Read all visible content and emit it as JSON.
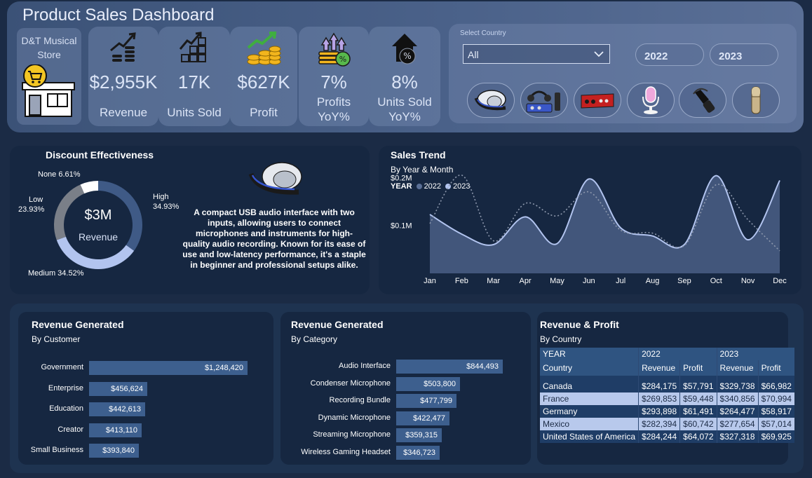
{
  "header": {
    "title": "Product Sales Dashboard",
    "store_name": "D&T Musical Store",
    "kpis": [
      {
        "value": "$2,955K",
        "label": "Revenue",
        "icon": "growth-coins-icon"
      },
      {
        "value": "17K",
        "label": "Units Sold",
        "icon": "boxes-growth-icon"
      },
      {
        "value": "$627K",
        "label": "Profit",
        "icon": "profit-coins-icon"
      },
      {
        "value": "7%",
        "label": "Profits YoY%",
        "icon": "profit-arrows-icon"
      },
      {
        "value": "8%",
        "label": "Units Sold YoY%",
        "icon": "house-percent-icon"
      }
    ],
    "country_filter": {
      "label": "Select Country",
      "value": "All"
    },
    "years": [
      "2022",
      "2023"
    ],
    "product_icons": [
      "headset-icon",
      "recording-bundle-icon",
      "audio-interface-icon",
      "streaming-mic-icon",
      "dynamic-mic-icon",
      "condenser-mic-icon"
    ]
  },
  "discount": {
    "title": "Discount Effectiveness",
    "center_value": "$3M",
    "center_label": "Revenue",
    "segments": [
      {
        "name": "High",
        "pct": "34.93%",
        "value": 34.93,
        "color": "#3f5a86"
      },
      {
        "name": "Medium",
        "pct": "34.52%",
        "value": 34.52,
        "color": "#b2c4ef"
      },
      {
        "name": "Low",
        "pct": "23.93%",
        "value": 23.93,
        "color": "#7a7f88"
      },
      {
        "name": "None",
        "pct": "6.61%",
        "value": 6.61,
        "color": "#ffffff"
      }
    ],
    "labels": {
      "none": "None 6.61%",
      "low_name": "Low",
      "low_pct": "23.93%",
      "high_name": "High",
      "high_pct": "34.93%",
      "medium": "Medium 34.52%"
    },
    "description": "A compact USB audio interface with two inputs, allowing users to connect microphones and instruments for high-quality audio recording. Known for its ease of use and low-latency performance, it's a staple in beginner and professional setups alike."
  },
  "sales_trend": {
    "title": "Sales Trend",
    "subtitle": "By Year & Month",
    "legend_title": "YEAR",
    "legend": [
      {
        "name": "2022",
        "color": "#5a6f96"
      },
      {
        "name": "2023",
        "color": "#b2c4ef"
      }
    ],
    "y_ticks": [
      "$0.2M",
      "$0.1M"
    ]
  },
  "chart_data": {
    "type": "area",
    "title": "Sales Trend",
    "subtitle": "By Year & Month",
    "x": [
      "Jan",
      "Feb",
      "Mar",
      "Apr",
      "May",
      "Jun",
      "Jul",
      "Aug",
      "Sep",
      "Oct",
      "Nov",
      "Dec"
    ],
    "series": [
      {
        "name": "2023",
        "values": [
          0.123,
          0.082,
          0.06,
          0.118,
          0.062,
          0.197,
          0.095,
          0.078,
          0.06,
          0.204,
          0.07,
          0.194
        ]
      },
      {
        "name": "2022",
        "values": [
          0.104,
          0.205,
          0.068,
          0.146,
          0.12,
          0.17,
          0.09,
          0.084,
          0.058,
          0.185,
          0.112,
          0.047
        ]
      }
    ],
    "ylim": [
      0,
      0.27
    ],
    "y_ticks": [
      0.1,
      0.2
    ],
    "grid": false,
    "legend": "top-left"
  },
  "rev_customer": {
    "title": "Revenue Generated",
    "subtitle": "By Customer",
    "max": 1248420,
    "items": [
      {
        "label": "Government",
        "value": 1248420,
        "display": "$1,248,420"
      },
      {
        "label": "Enterprise",
        "value": 456624,
        "display": "$456,624"
      },
      {
        "label": "Education",
        "value": 442613,
        "display": "$442,613"
      },
      {
        "label": "Creator",
        "value": 413110,
        "display": "$413,110"
      },
      {
        "label": "Small Business",
        "value": 393840,
        "display": "$393,840"
      }
    ]
  },
  "rev_category": {
    "title": "Revenue Generated",
    "subtitle": "By Category",
    "max": 844493,
    "items": [
      {
        "label": "Audio Interface",
        "value": 844493,
        "display": "$844,493"
      },
      {
        "label": "Condenser Microphone",
        "value": 503800,
        "display": "$503,800"
      },
      {
        "label": "Recording Bundle",
        "value": 477799,
        "display": "$477,799"
      },
      {
        "label": "Dynamic Microphone",
        "value": 422477,
        "display": "$422,477"
      },
      {
        "label": "Streaming Microphone",
        "value": 359315,
        "display": "$359,315"
      },
      {
        "label": "Wireless Gaming Headset",
        "value": 346723,
        "display": "$346,723"
      }
    ]
  },
  "rev_profit": {
    "title": "Revenue & Profit",
    "subtitle": "By Country",
    "year_header": "YEAR",
    "years": [
      "2022",
      "2023"
    ],
    "country_header": "Country",
    "col_headers": [
      "Revenue",
      "Profit",
      "Revenue",
      "Profit"
    ],
    "rows": [
      {
        "country": "Canada",
        "cells": [
          "$284,175",
          "$57,791",
          "$329,738",
          "$66,982"
        ]
      },
      {
        "country": "France",
        "cells": [
          "$269,853",
          "$59,448",
          "$340,856",
          "$70,994"
        ]
      },
      {
        "country": "Germany",
        "cells": [
          "$293,898",
          "$61,491",
          "$264,477",
          "$58,917"
        ]
      },
      {
        "country": "Mexico",
        "cells": [
          "$282,394",
          "$60,742",
          "$277,654",
          "$57,014"
        ]
      },
      {
        "country": "United States of America",
        "cells": [
          "$284,244",
          "$64,072",
          "$327,318",
          "$69,925"
        ]
      }
    ]
  }
}
